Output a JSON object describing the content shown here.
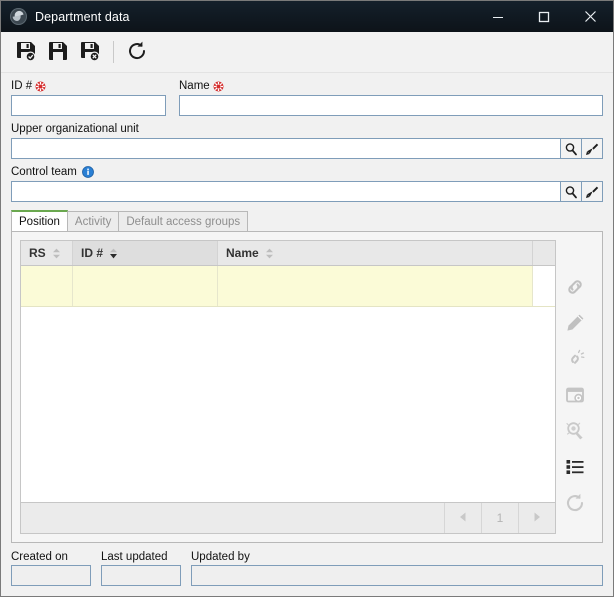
{
  "window": {
    "title": "Department data",
    "app_icon": "globe-icon",
    "controls": {
      "minimize": "minimize-icon",
      "maximize": "maximize-icon",
      "close": "close-icon"
    }
  },
  "toolbar": {
    "buttons": [
      {
        "name": "save-new-button",
        "icon": "floppy-add-icon",
        "tooltip": "Save and new"
      },
      {
        "name": "save-button",
        "icon": "floppy-icon",
        "tooltip": "Save"
      },
      {
        "name": "save-close-button",
        "icon": "floppy-delete-icon",
        "tooltip": "Save and close"
      },
      {
        "name": "refresh-button",
        "icon": "refresh-icon",
        "tooltip": "Refresh"
      }
    ]
  },
  "form": {
    "id": {
      "label": "ID #",
      "required": true,
      "value": "",
      "placeholder": ""
    },
    "name": {
      "label": "Name",
      "required": true,
      "value": "",
      "placeholder": ""
    },
    "upper_org_unit": {
      "label": "Upper organizational unit",
      "value": "",
      "placeholder": "",
      "search_icon": "magnifier-icon",
      "clear_icon": "brush-icon"
    },
    "control_team": {
      "label": "Control team",
      "info": "info-icon",
      "value": "",
      "placeholder": "",
      "search_icon": "magnifier-icon",
      "clear_icon": "brush-icon"
    }
  },
  "tabs": [
    {
      "label": "Position",
      "active": true,
      "enabled": true
    },
    {
      "label": "Activity",
      "active": false,
      "enabled": false
    },
    {
      "label": "Default access groups",
      "active": false,
      "enabled": false
    }
  ],
  "grid": {
    "columns": [
      {
        "label": "RS",
        "sorted": false,
        "sort_icon": "sort-both-icon"
      },
      {
        "label": "ID #",
        "sorted": true,
        "sort_icon": "sort-desc-icon"
      },
      {
        "label": "Name",
        "sorted": false,
        "sort_icon": "sort-both-icon"
      }
    ],
    "rows": [
      {
        "rs": "",
        "id": "",
        "name": "",
        "highlight": true
      }
    ],
    "pagination": {
      "prev_icon": "triangle-left-icon",
      "page": "1",
      "next_icon": "triangle-right-icon"
    }
  },
  "side_tools": [
    {
      "name": "link-button",
      "icon": "chain-link-icon",
      "enabled": false
    },
    {
      "name": "edit-button",
      "icon": "pencil-icon",
      "enabled": false
    },
    {
      "name": "unlink-button",
      "icon": "broken-chain-icon",
      "enabled": false
    },
    {
      "name": "card-button",
      "icon": "window-card-icon",
      "enabled": false
    },
    {
      "name": "stamp-button",
      "icon": "stamp-seal-icon",
      "enabled": false
    },
    {
      "name": "list-button",
      "icon": "list-icon",
      "enabled": true
    },
    {
      "name": "grid-refresh-button",
      "icon": "refresh-icon",
      "enabled": false
    }
  ],
  "footer": {
    "created_on": {
      "label": "Created on",
      "value": "",
      "readonly": true
    },
    "last_updated": {
      "label": "Last updated",
      "value": "",
      "readonly": true
    },
    "updated_by": {
      "label": "Updated by",
      "value": "",
      "readonly": true
    }
  },
  "colors": {
    "titlebar": "#0f1920",
    "accent_tab": "#6aa84f",
    "required_marker": "#d42b2b",
    "info": "#2a7fd4",
    "row_highlight": "#fbfbd7",
    "field_border": "#7f9db9"
  }
}
